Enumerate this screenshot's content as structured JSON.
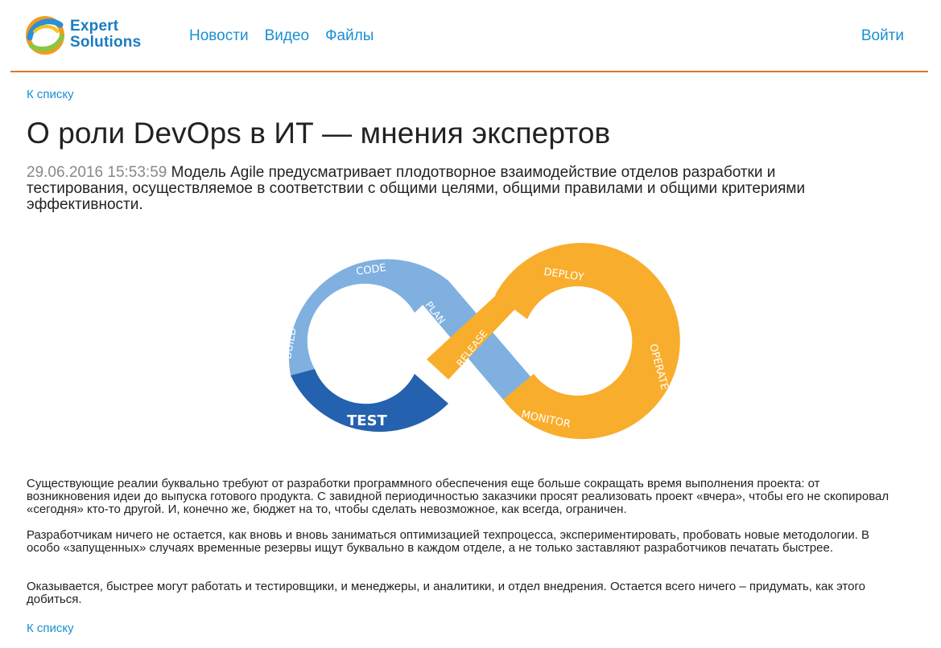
{
  "header": {
    "logo_line1": "Expert",
    "logo_line2": "Solutions",
    "nav": [
      "Новости",
      "Видео",
      "Файлы"
    ],
    "login_label": "Войти"
  },
  "article": {
    "back_link_top": "К списку",
    "title": "О роли DevOps в ИТ — мнения экспертов",
    "date": "29.06.2016 15:53:59",
    "lead": "Модель Agile предусматривает плодотворное взаимодействие отделов разработки и тестирования, осуществляемое в соответствии с общими целями, общими правилами и общими критериями эффективности.",
    "diagram": {
      "labels": {
        "code": "CODE",
        "build": "BUILD",
        "test": "TEST",
        "plan": "PLAN",
        "release": "RELEASE",
        "deploy": "DEPLOY",
        "operate": "OPERATE",
        "monitor": "MONITOR"
      },
      "colors": {
        "light_blue": "#7fb0df",
        "dark_blue": "#2461ae",
        "orange": "#f9ad2c"
      }
    },
    "paragraphs": [
      "Существующие реалии буквально требуют от разработки программного обеспечения еще больше сокращать время выполнения проекта: от возникновения идеи до выпуска готового продукта. С завидной периодичностью заказчики просят реализовать проект «вчера», чтобы его не скопировал «сегодня» кто-то другой. И, конечно же, бюджет на то, чтобы сделать невозможное, как всегда, ограничен.",
      "Разработчикам ничего не остается, как вновь и вновь заниматься оптимизацией техпроцесса, экспериментировать, пробовать новые методологии. В особо «запущенных» случаях временные резервы ищут буквально в каждом отделе, а не только заставляют разработчиков печатать быстрее.",
      "Оказывается, быстрее могут работать и тестировщики, и менеджеры, и аналитики, и отдел внедрения. Остается всего ничего – придумать, как этого добиться."
    ],
    "back_link_bottom": "К списку"
  }
}
